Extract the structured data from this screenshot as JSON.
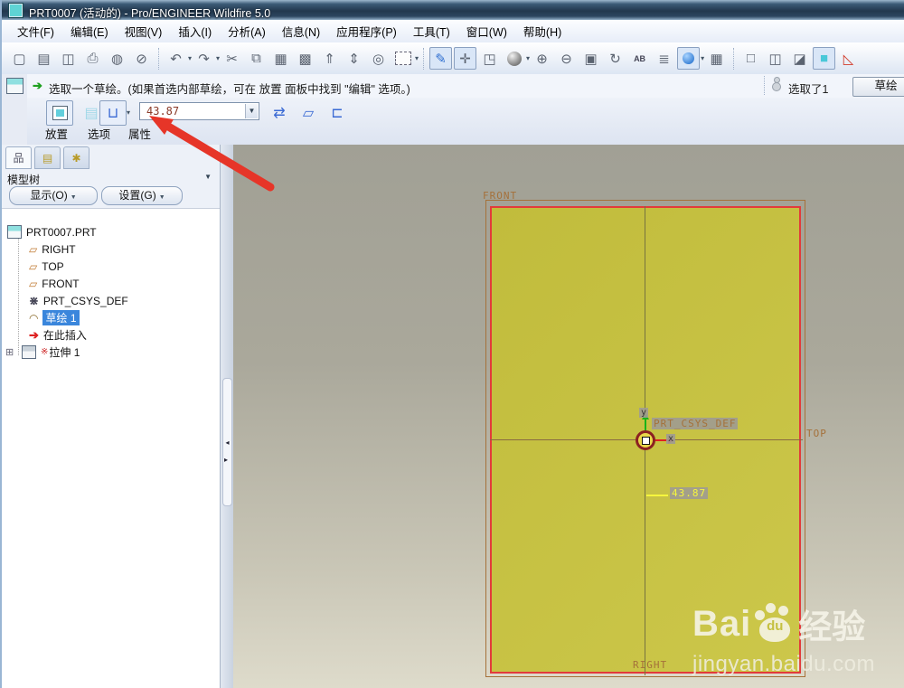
{
  "window": {
    "title": "PRT0007 (活动的) - Pro/ENGINEER Wildfire 5.0"
  },
  "menu": {
    "items": [
      {
        "key": "file",
        "label": "文件(F)"
      },
      {
        "key": "edit",
        "label": "编辑(E)"
      },
      {
        "key": "view",
        "label": "视图(V)"
      },
      {
        "key": "insert",
        "label": "插入(I)"
      },
      {
        "key": "analysis",
        "label": "分析(A)"
      },
      {
        "key": "info",
        "label": "信息(N)"
      },
      {
        "key": "applications",
        "label": "应用程序(P)"
      },
      {
        "key": "tools",
        "label": "工具(T)"
      },
      {
        "key": "window",
        "label": "窗口(W)"
      },
      {
        "key": "help",
        "label": "帮助(H)"
      }
    ]
  },
  "toolbar": {
    "groups": [
      {
        "icons": [
          {
            "name": "new-file-icon",
            "glyph": "▢"
          },
          {
            "name": "open-file-icon",
            "glyph": "▤"
          },
          {
            "name": "save-icon",
            "glyph": "◫"
          },
          {
            "name": "print-icon",
            "glyph": "⎙"
          },
          {
            "name": "erase-not-displayed-icon",
            "glyph": "◍"
          },
          {
            "name": "delete-old-versions-icon",
            "glyph": "⊘"
          }
        ]
      },
      {
        "icons": [
          {
            "name": "undo-icon",
            "glyph": "↶",
            "dropdown": true
          },
          {
            "name": "redo-icon",
            "glyph": "↷",
            "dropdown": true
          },
          {
            "name": "cut-icon",
            "glyph": "✂"
          },
          {
            "name": "copy-icon",
            "glyph": "⧉"
          },
          {
            "name": "paste-icon",
            "glyph": "▦"
          },
          {
            "name": "paste-special-icon",
            "glyph": "▩"
          },
          {
            "name": "regenerate-icon",
            "glyph": "⇑"
          },
          {
            "name": "regenerate-custom-icon",
            "glyph": "⇕"
          },
          {
            "name": "find-icon",
            "glyph": "◎"
          },
          {
            "name": "selection-filter-box",
            "type": "selbox",
            "dropdown": true
          }
        ]
      },
      {
        "icons": [
          {
            "name": "repaint-icon",
            "glyph": "✎",
            "pressed": true,
            "accent": true
          },
          {
            "name": "spin-center-icon",
            "glyph": "✛",
            "pressed": true
          },
          {
            "name": "orient-mode-icon",
            "glyph": "◳"
          },
          {
            "name": "shading-sphere-icon",
            "type": "sphere",
            "dropdown": true
          },
          {
            "name": "zoom-in-icon",
            "glyph": "⊕"
          },
          {
            "name": "zoom-out-icon",
            "glyph": "⊖"
          },
          {
            "name": "zoom-fit-icon",
            "glyph": "▣"
          },
          {
            "name": "reorient-view-icon",
            "glyph": "↻"
          },
          {
            "name": "saved-views-icon",
            "glyph": "AB",
            "small": true
          },
          {
            "name": "layers-icon",
            "glyph": "≣"
          },
          {
            "name": "datum-display-icon",
            "type": "ball",
            "pressed": true,
            "dropdown": true
          },
          {
            "name": "screen-capture-icon",
            "glyph": "▦"
          }
        ]
      },
      {
        "icons": [
          {
            "name": "wireframe-view-icon",
            "glyph": "□"
          },
          {
            "name": "hidden-line-view-icon",
            "glyph": "◫"
          },
          {
            "name": "no-hidden-view-icon",
            "glyph": "◪"
          },
          {
            "name": "shaded-view-icon",
            "glyph": "■",
            "pressed": true,
            "cyan": true
          },
          {
            "name": "datum-planes-toggle-icon",
            "glyph": "◺",
            "red": true
          }
        ]
      }
    ]
  },
  "message": {
    "text": "选取一个草绘。(如果首选内部草绘，可在 放置 面板中找到 \"编辑\" 选项。)",
    "selected_status": "选取了1",
    "action_button": "草绘"
  },
  "dashboard": {
    "feature_icons": [
      {
        "name": "solid-type-button",
        "type": "solid",
        "pressed": true
      },
      {
        "name": "surface-type-button",
        "type": "surface"
      },
      {
        "name": "depth-option-button",
        "glyph": "⊔",
        "pressed": true,
        "dropdown": true
      }
    ],
    "depth_value": "43.87",
    "modifier_icons": [
      {
        "name": "flip-direction-button",
        "glyph": "⇄"
      },
      {
        "name": "thicken-sketch-button",
        "glyph": "▱"
      },
      {
        "name": "remove-material-button",
        "glyph": "⊏"
      }
    ],
    "tabs": [
      "放置",
      "选项",
      "属性"
    ]
  },
  "navigator": {
    "tabs": [
      {
        "name": "tab-model-tree",
        "glyph": "品",
        "selected": true
      },
      {
        "name": "tab-folder-browser",
        "glyph": "▤",
        "yellow": true
      },
      {
        "name": "tab-favorites",
        "glyph": "✱",
        "yellow": true
      }
    ],
    "title": "模型树",
    "show_button": "显示(O)",
    "settings_button": "设置(G)",
    "tree_items": [
      {
        "key": "prt0007",
        "label": "PRT0007.PRT",
        "icon": "part",
        "depth": 0
      },
      {
        "key": "right-plane",
        "label": "RIGHT",
        "icon": "datum-plane",
        "depth": 1
      },
      {
        "key": "top-plane",
        "label": "TOP",
        "icon": "datum-plane",
        "depth": 1
      },
      {
        "key": "front-plane",
        "label": "FRONT",
        "icon": "datum-plane",
        "depth": 1
      },
      {
        "key": "csys",
        "label": "PRT_CSYS_DEF",
        "icon": "csys",
        "depth": 1
      },
      {
        "key": "sketch-1",
        "label": "草绘 1",
        "icon": "sketch",
        "depth": 1,
        "selected": true
      },
      {
        "key": "insert-here",
        "label": "在此插入",
        "icon": "insert-arrow",
        "depth": 1
      },
      {
        "key": "extrude-1",
        "label": "拉伸 1",
        "icon": "extrude",
        "depth": 0,
        "expander": "⊞",
        "flag": "※"
      }
    ]
  },
  "graphics": {
    "front_label": "FRONT",
    "top_label": "TOP",
    "right_label": "RIGHT",
    "csys_label": "PRT_CSYS_DEF",
    "axis_x_label": "x",
    "axis_y_label": "y",
    "dimension_label": "43.87"
  },
  "watermark": {
    "brand_prefix": "Bai",
    "brand_paw_text": "du",
    "brand_suffix": "经验",
    "url": "jingyan.baidu.com"
  },
  "colors": {
    "sketch_fill": "#c6c142",
    "sketch_border": "#e23b3b",
    "datum_brown": "#a5713a",
    "dimension_yellow": "#f6f63e",
    "selection_blue": "#3a86dc",
    "annotation_red": "#e63528"
  }
}
